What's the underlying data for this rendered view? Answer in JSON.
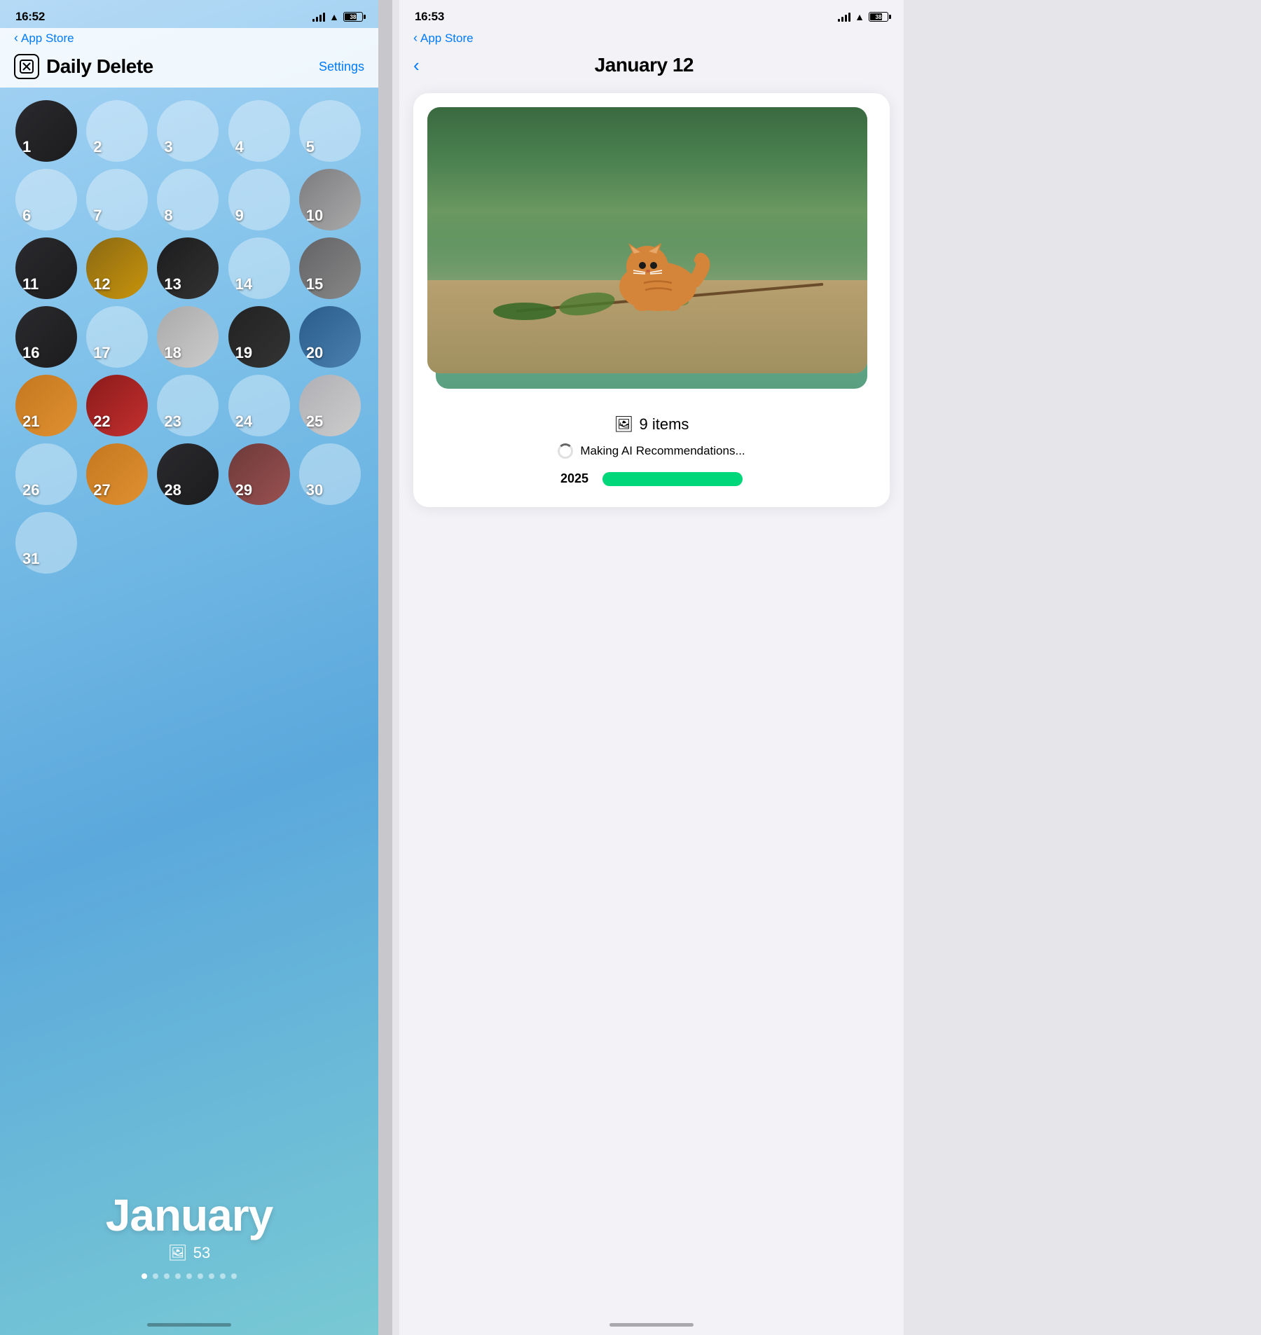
{
  "left_phone": {
    "status": {
      "time": "16:52",
      "battery": "38"
    },
    "nav": {
      "back_label": "App Store",
      "settings_label": "Settings"
    },
    "app": {
      "title": "Daily Delete",
      "icon_symbol": "✕"
    },
    "calendar": {
      "month": "January",
      "photo_count": "53",
      "days": [
        {
          "num": 1,
          "has_photo": true,
          "col": 1,
          "photo_type": "photo-dark"
        },
        {
          "num": 2,
          "has_photo": false,
          "col": 2
        },
        {
          "num": 3,
          "has_photo": false,
          "col": 3
        },
        {
          "num": 4,
          "has_photo": false,
          "col": 4
        },
        {
          "num": 5,
          "has_photo": false,
          "col": 5
        },
        {
          "num": 6,
          "has_photo": false,
          "col": 1
        },
        {
          "num": 7,
          "has_photo": false,
          "col": 2
        },
        {
          "num": 8,
          "has_photo": false,
          "col": 3
        },
        {
          "num": 9,
          "has_photo": false,
          "col": 4
        },
        {
          "num": 10,
          "has_photo": true,
          "col": 5,
          "photo_type": "photo-car"
        },
        {
          "num": 11,
          "has_photo": true,
          "col": 1,
          "photo_type": "photo-dark"
        },
        {
          "num": 12,
          "has_photo": true,
          "col": 2,
          "photo_type": "photo-brown"
        },
        {
          "num": 13,
          "has_photo": true,
          "col": 3,
          "photo_type": "photo-black"
        },
        {
          "num": 14,
          "has_photo": false,
          "col": 4
        },
        {
          "num": 15,
          "has_photo": true,
          "col": 5,
          "photo_type": "photo-gray"
        },
        {
          "num": 16,
          "has_photo": true,
          "col": 1,
          "photo_type": "photo-dark"
        },
        {
          "num": 17,
          "has_photo": false,
          "col": 2
        },
        {
          "num": 18,
          "has_photo": true,
          "col": 3,
          "photo_type": "photo-snowy"
        },
        {
          "num": 19,
          "has_photo": true,
          "col": 4,
          "photo_type": "photo-night"
        },
        {
          "num": 20,
          "has_photo": true,
          "col": 5,
          "photo_type": "photo-blue"
        },
        {
          "num": 21,
          "has_photo": true,
          "col": 1,
          "photo_type": "photo-cat"
        },
        {
          "num": 22,
          "has_photo": true,
          "col": 2,
          "photo_type": "photo-red"
        },
        {
          "num": 23,
          "has_photo": false,
          "col": 3
        },
        {
          "num": 24,
          "has_photo": false,
          "col": 4
        },
        {
          "num": 25,
          "has_photo": true,
          "col": 5,
          "photo_type": "photo-light"
        },
        {
          "num": 26,
          "has_photo": false,
          "col": 1
        },
        {
          "num": 27,
          "has_photo": true,
          "col": 2,
          "photo_type": "photo-cat"
        },
        {
          "num": 28,
          "has_photo": true,
          "col": 3,
          "photo_type": "photo-dark"
        },
        {
          "num": 29,
          "has_photo": true,
          "col": 4,
          "photo_type": "photo-clothes"
        },
        {
          "num": 30,
          "has_photo": false,
          "col": 5
        },
        {
          "num": 31,
          "has_photo": false,
          "col": 1
        }
      ],
      "page_dots": 9,
      "active_dot": 0
    }
  },
  "right_phone": {
    "status": {
      "time": "16:53",
      "battery": "38"
    },
    "nav": {
      "back_label": "App Store",
      "back_chevron": "‹"
    },
    "detail": {
      "title": "January 12",
      "items_count": "9 items",
      "items_icon": "🖼",
      "ai_text": "Making AI Recommendations...",
      "year_label": "2025",
      "bar_color": "#00D67A"
    }
  }
}
